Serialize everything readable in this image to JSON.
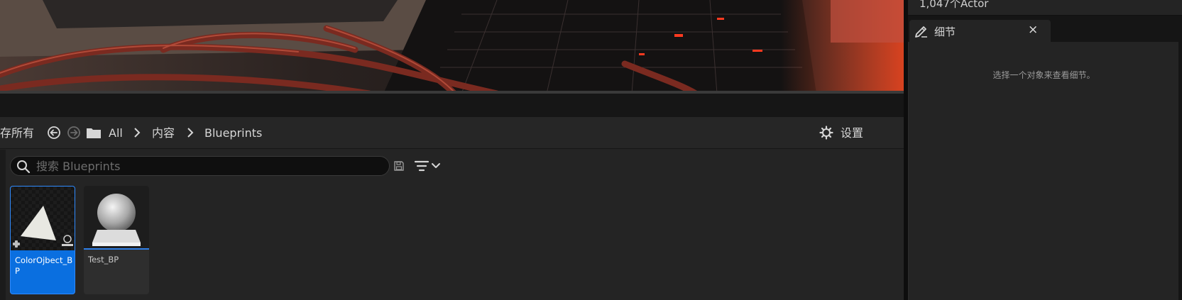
{
  "outliner": {
    "actor_count": "1,047个Actor"
  },
  "details": {
    "tab_label": "细节",
    "close_glyph": "×",
    "empty_message": "选择一个对象来查看细节。"
  },
  "content_browser": {
    "save_all_label": "存所有",
    "breadcrumb": {
      "all": "All",
      "content": "内容",
      "blueprints": "Blueprints"
    },
    "settings_label": "设置",
    "search": {
      "placeholder": "搜索 Blueprints",
      "value": ""
    },
    "assets": [
      {
        "name": "ColorOjbect_BP",
        "selected": true,
        "thumbnail": "triangle-material-icon"
      },
      {
        "name": "Test_BP",
        "selected": false,
        "thumbnail": "sphere-on-pedestal-icon"
      }
    ]
  },
  "colors": {
    "selection_blue": "#0a6fe0",
    "panel_bg": "#242424",
    "accent_underline": "#2f7fe8"
  }
}
